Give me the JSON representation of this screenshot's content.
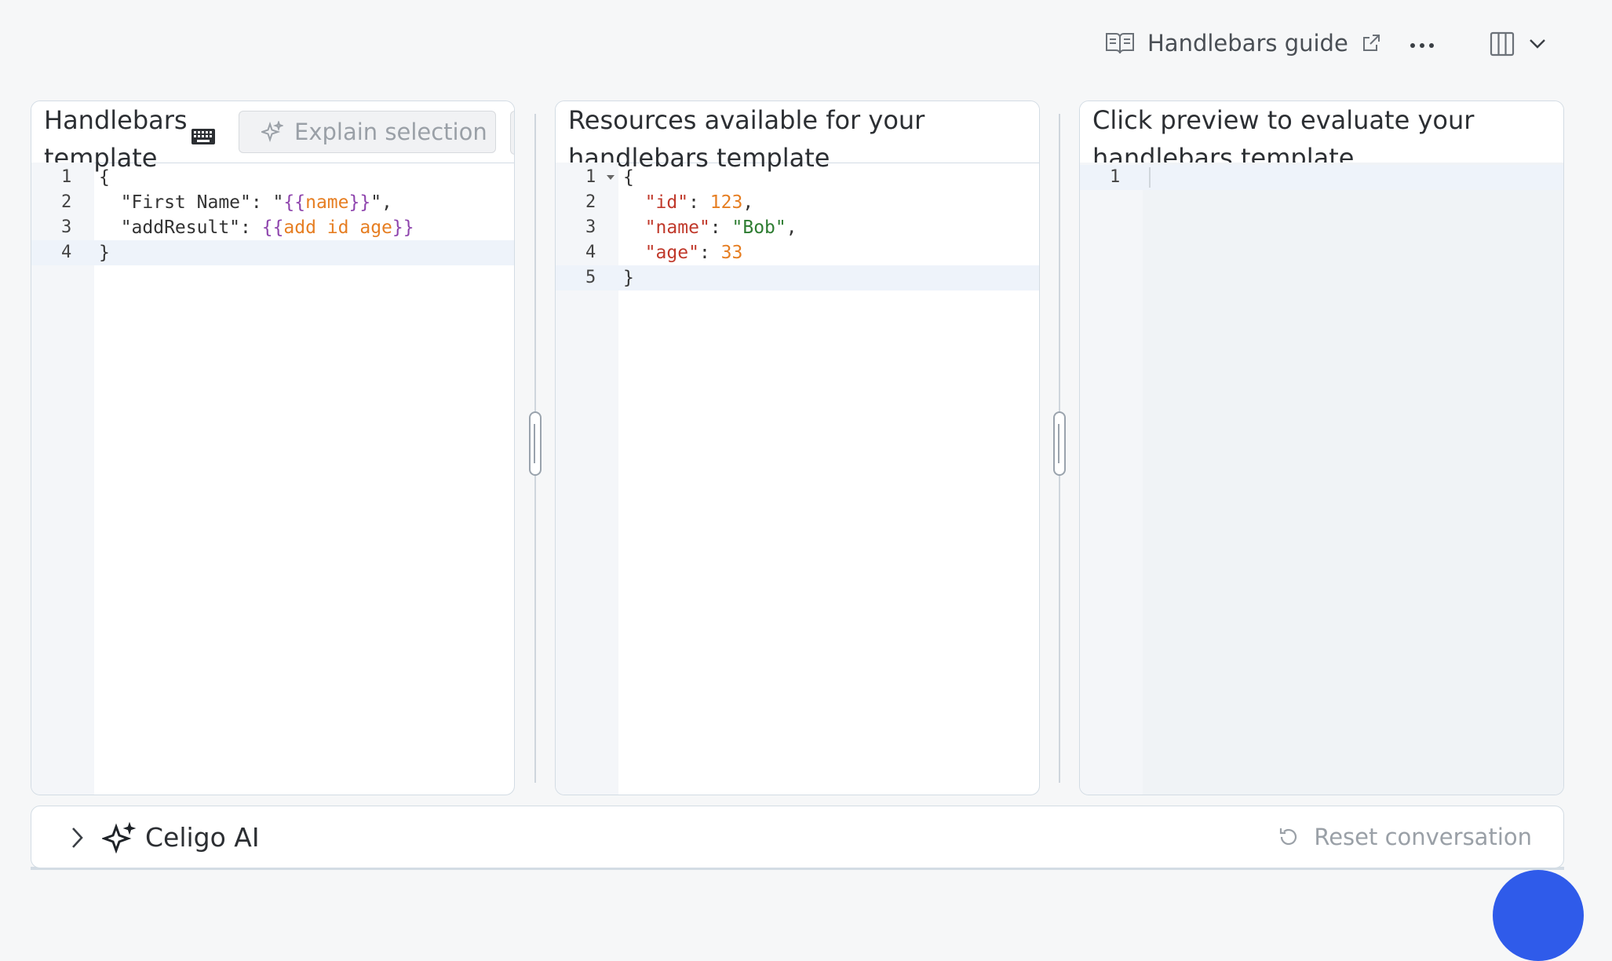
{
  "toolbar": {
    "guide_label": "Handlebars guide",
    "guide_icon": "book-icon",
    "external_icon": "external-link-icon",
    "more_icon": "more-horizontal-icon",
    "layout_icon": "columns-icon",
    "layout_chevron": "chevron-down-icon"
  },
  "panels": {
    "template": {
      "title": "Handlebars template",
      "keyboard_icon": "keyboard-icon",
      "explain_label": "Explain selection",
      "lines": [
        {
          "n": "1",
          "tokens": [
            {
              "t": "{",
              "c": "tx"
            }
          ]
        },
        {
          "n": "2",
          "tokens": [
            {
              "t": "  \"First Name\": \"",
              "c": "tx"
            },
            {
              "t": "{{",
              "c": "mu"
            },
            {
              "t": "name",
              "c": "or"
            },
            {
              "t": "}}",
              "c": "mu"
            },
            {
              "t": "\",",
              "c": "tx"
            }
          ]
        },
        {
          "n": "3",
          "tokens": [
            {
              "t": "  \"addResult\": ",
              "c": "tx"
            },
            {
              "t": "{{",
              "c": "mu"
            },
            {
              "t": "add id age",
              "c": "or"
            },
            {
              "t": "}}",
              "c": "mu"
            }
          ]
        },
        {
          "n": "4",
          "tokens": [
            {
              "t": "}",
              "c": "tx"
            }
          ]
        }
      ],
      "active_line": 3
    },
    "resources": {
      "title": "Resources available for your handlebars template",
      "lines": [
        {
          "n": "1",
          "tokens": [
            {
              "t": "{",
              "c": "tx"
            }
          ]
        },
        {
          "n": "2",
          "tokens": [
            {
              "t": "  ",
              "c": "tx"
            },
            {
              "t": "\"id\"",
              "c": "key"
            },
            {
              "t": ": ",
              "c": "tx"
            },
            {
              "t": "123",
              "c": "num"
            },
            {
              "t": ",",
              "c": "tx"
            }
          ]
        },
        {
          "n": "3",
          "tokens": [
            {
              "t": "  ",
              "c": "tx"
            },
            {
              "t": "\"name\"",
              "c": "key"
            },
            {
              "t": ": ",
              "c": "tx"
            },
            {
              "t": "\"Bob\"",
              "c": "grn"
            },
            {
              "t": ",",
              "c": "tx"
            }
          ]
        },
        {
          "n": "4",
          "tokens": [
            {
              "t": "  ",
              "c": "tx"
            },
            {
              "t": "\"age\"",
              "c": "key"
            },
            {
              "t": ": ",
              "c": "tx"
            },
            {
              "t": "33",
              "c": "num"
            }
          ]
        },
        {
          "n": "5",
          "tokens": [
            {
              "t": "}",
              "c": "tx"
            }
          ]
        }
      ],
      "active_line": 4
    },
    "preview": {
      "title": "Click preview to evaluate your handlebars template",
      "lines": [
        {
          "n": "1",
          "tokens": []
        }
      ],
      "active_line": 0
    }
  },
  "ai": {
    "title": "Celigo AI",
    "expand_icon": "chevron-right-icon",
    "sparkle_icon": "sparkle-icon",
    "reset_icon": "reset-icon",
    "reset_label": "Reset conversation"
  },
  "colors": {
    "accent": "#2f5bea",
    "border": "#d3dce4",
    "muted_text": "#9aa0a7"
  }
}
